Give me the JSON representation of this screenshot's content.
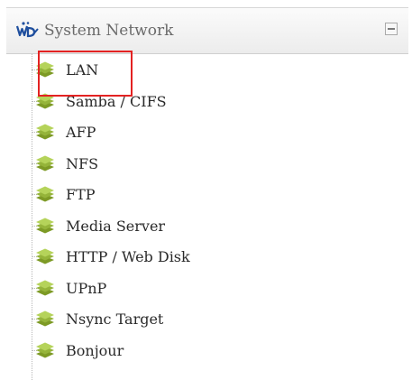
{
  "panel": {
    "title": "System Network",
    "logo_icon": "wd-logo-icon",
    "collapse_icon": "collapse-icon"
  },
  "menu": {
    "item_icon": "stack-layers-icon",
    "items": [
      {
        "label": "LAN"
      },
      {
        "label": "Samba / CIFS"
      },
      {
        "label": "AFP"
      },
      {
        "label": "NFS"
      },
      {
        "label": "FTP"
      },
      {
        "label": "Media Server"
      },
      {
        "label": "HTTP / Web Disk"
      },
      {
        "label": "UPnP"
      },
      {
        "label": "Nsync Target"
      },
      {
        "label": "Bonjour"
      }
    ]
  },
  "colors": {
    "highlight": "#e32222",
    "icon_green_dark": "#7d9a25",
    "icon_green_light": "#b5d35a",
    "title_text": "#6a6a6a",
    "item_text": "#2a2a2a"
  }
}
